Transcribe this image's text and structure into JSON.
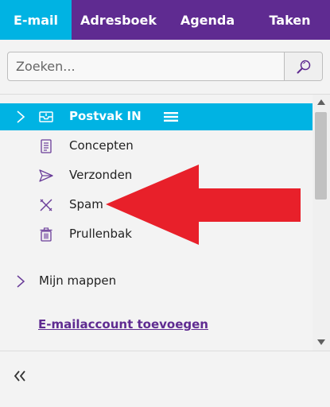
{
  "tabs": [
    {
      "label": "E-mail"
    },
    {
      "label": "Adresboek"
    },
    {
      "label": "Agenda"
    },
    {
      "label": "Taken"
    }
  ],
  "search": {
    "placeholder": "Zoeken..."
  },
  "folders": [
    {
      "label": "Postvak IN",
      "icon": "inbox-icon",
      "selected": true
    },
    {
      "label": "Concepten",
      "icon": "draft-icon"
    },
    {
      "label": "Verzonden",
      "icon": "send-icon"
    },
    {
      "label": "Spam",
      "icon": "spam-icon"
    },
    {
      "label": "Prullenbak",
      "icon": "trash-icon"
    }
  ],
  "my_folders": {
    "label": "Mijn mappen"
  },
  "add_account": {
    "label": "E-mailaccount toevoegen"
  },
  "colors": {
    "accent": "#00b3e3",
    "brand": "#5f2b91",
    "annotation": "#e8202a"
  }
}
